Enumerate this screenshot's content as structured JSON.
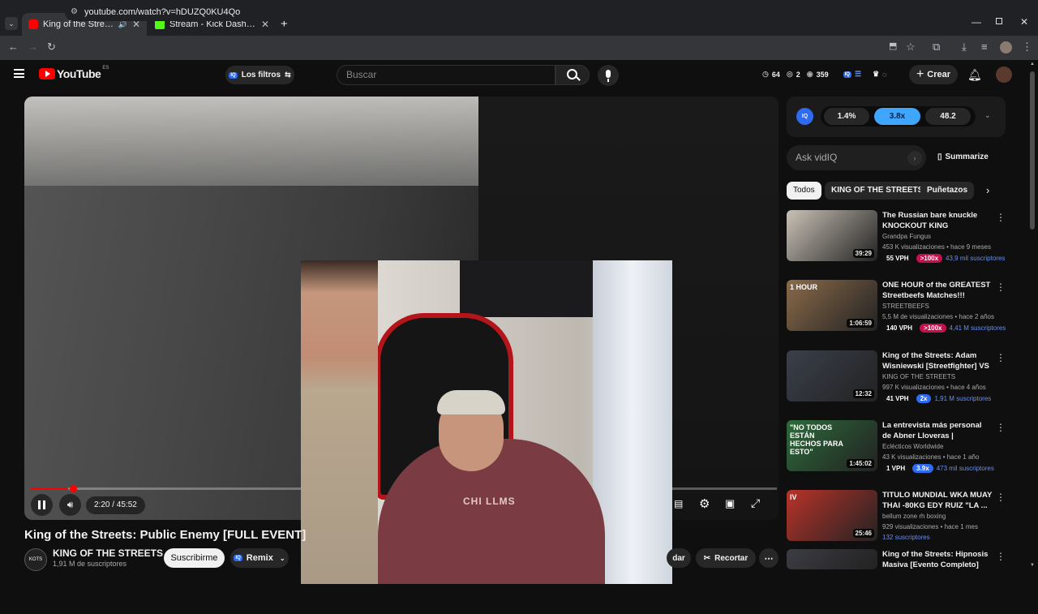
{
  "browser": {
    "tabs": [
      {
        "title": "King of the Streets: Public E",
        "favicon_color": "#ff0000"
      },
      {
        "title": "Stream - Kick Dashboard",
        "favicon_color": "#53fc18"
      }
    ],
    "url": "youtube.com/watch?v=hDUZQ0KU4Qo"
  },
  "youtube": {
    "logo": "YouTube",
    "region": "ES",
    "filters_label": "Los filtros",
    "search_placeholder": "Buscar",
    "stats": {
      "a": "64",
      "b": "2",
      "c": "359"
    },
    "create_label": "Crear"
  },
  "player": {
    "time": "2:20 / 45:52",
    "progress_fraction": 0.05,
    "shirt_text": "CHI LLMS"
  },
  "video": {
    "title": "King of the Streets: Public Enemy [FULL EVENT]",
    "channel": "KING OF THE STREETS",
    "channel_avatar_text": "KOTS",
    "subscribers": "1,91 M de suscriptores",
    "subscribe_label": "Suscribirme",
    "remix_label": "Remix",
    "download_partial": "dar",
    "clip_label": "Recortar"
  },
  "vidiq": {
    "badge": "IQ",
    "stats": [
      "1.4%",
      "3.8x",
      "48.2"
    ],
    "ask_placeholder": "Ask vidIQ",
    "summarize_label": "Summarize"
  },
  "chips": [
    "Todos",
    "KING OF THE STREETS",
    "Puñetazos"
  ],
  "recommendations": [
    {
      "title": "The Russian bare knuckle KNOCKOUT KING hospitalisin...",
      "channel": "Grandpa Fungus",
      "meta": "453 K visualizaciones • hace 9 meses",
      "vph": "55 VPH",
      "badge": ">100x",
      "badge_type": "pink",
      "subs": "43,9 mil suscriptores",
      "duration": "39:29",
      "thumb_color": "#c9c2b6"
    },
    {
      "title": "ONE HOUR of the GREATEST Streetbeefs Matches!!!",
      "channel": "STREETBEEFS",
      "meta": "5,5 M de visualizaciones • hace 2 años",
      "vph": "140 VPH",
      "badge": ">100x",
      "badge_type": "pink",
      "subs": "4,41 M suscriptores",
      "duration": "1:06:59",
      "thumb_color": "#8a6a4a",
      "thumb_label": "1 HOUR"
    },
    {
      "title": "King of the Streets: Adam Wisniewski [Streetfighter] VS ...",
      "channel": "KING OF THE STREETS",
      "meta": "997 K visualizaciones • hace 4 años",
      "vph": "41 VPH",
      "badge": "2x",
      "badge_type": "blue",
      "subs": "1,91 M suscriptores",
      "duration": "12:32",
      "thumb_color": "#3a3f4a"
    },
    {
      "title": "La entrevista más personal de Abner Lloveras | Eclécticos ...",
      "channel": "Eclécticos Worldwide",
      "meta": "43 K visualizaciones • hace 1 año",
      "vph": "1 VPH",
      "badge": "3.9x",
      "badge_type": "blue",
      "subs": "473 mil suscriptores",
      "duration": "1:45:02",
      "thumb_color": "#2d6a3a",
      "thumb_label": "\"NO TODOS ESTÁN HECHOS PARA ESTO\""
    },
    {
      "title": "TITULO MUNDIAL WKA MUAY THAI -80KG EDY RUIZ \"LA ...",
      "channel": "bellum zone rh boxing",
      "meta": "929 visualizaciones • hace 1 mes",
      "vph": "",
      "badge": "",
      "badge_type": "",
      "subs": "132 suscriptores",
      "duration": "25:46",
      "thumb_color": "#b8332a",
      "thumb_label": "IV"
    },
    {
      "title": "King of the Streets: Hipnosis Masiva [Evento Completo]",
      "channel": "",
      "meta": "",
      "vph": "",
      "badge": "",
      "badge_type": "",
      "subs": "",
      "duration": "",
      "thumb_color": "#3c3c44"
    }
  ]
}
